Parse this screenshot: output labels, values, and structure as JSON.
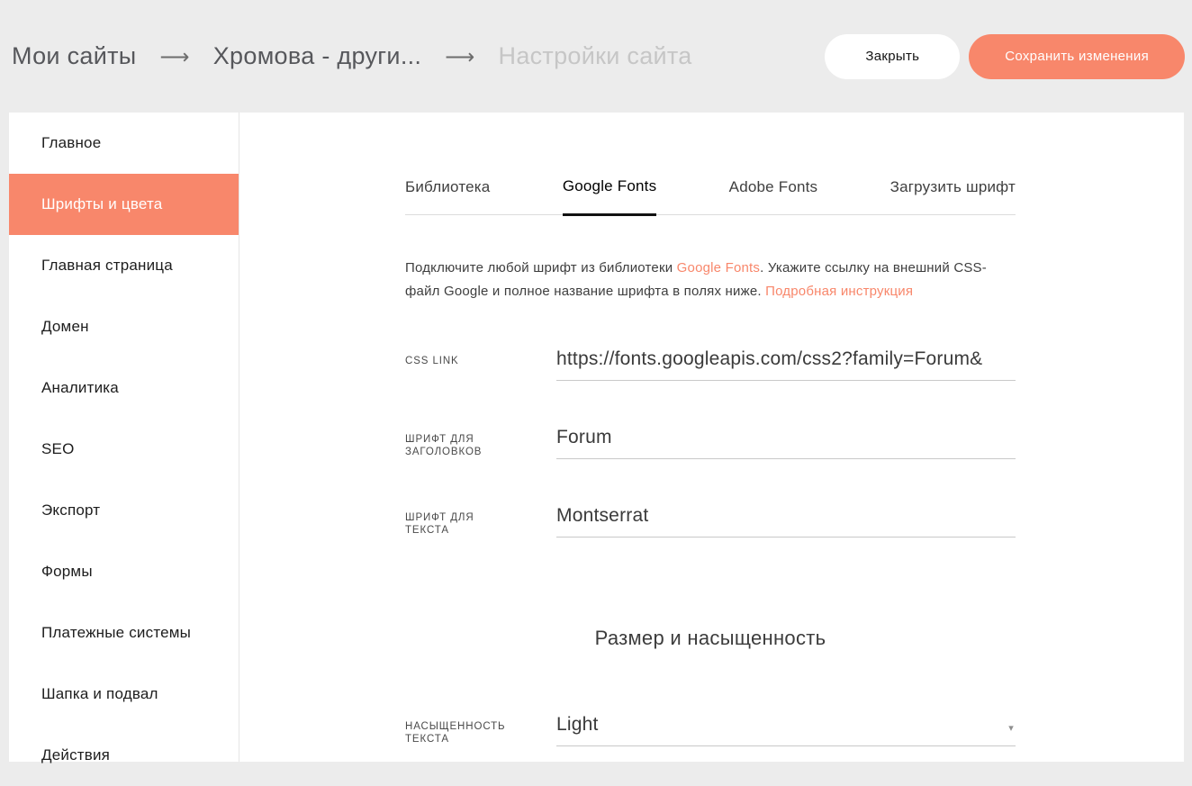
{
  "accent_color": "#f8876b",
  "icons": {
    "breadcrumb_arrow": "⟶",
    "caret_down": "▾"
  },
  "header": {
    "breadcrumb": [
      {
        "label": "Мои сайты"
      },
      {
        "label": "Хромова - други..."
      },
      {
        "label": "Настройки сайта"
      }
    ],
    "close_label": "Закрыть",
    "save_label": "Сохранить изменения"
  },
  "sidebar": {
    "items": [
      {
        "label": "Главное",
        "active": false
      },
      {
        "label": "Шрифты и цвета",
        "active": true
      },
      {
        "label": "Главная страница",
        "active": false
      },
      {
        "label": "Домен",
        "active": false
      },
      {
        "label": "Аналитика",
        "active": false
      },
      {
        "label": "SEO",
        "active": false
      },
      {
        "label": "Экспорт",
        "active": false
      },
      {
        "label": "Формы",
        "active": false
      },
      {
        "label": "Платежные системы",
        "active": false
      },
      {
        "label": "Шапка и подвал",
        "active": false
      },
      {
        "label": "Действия",
        "active": false
      }
    ]
  },
  "main": {
    "tabs": [
      {
        "label": "Библиотека",
        "active": false
      },
      {
        "label": "Google Fonts",
        "active": true
      },
      {
        "label": "Adobe Fonts",
        "active": false
      },
      {
        "label": "Загрузить шрифт",
        "active": false
      }
    ],
    "description": {
      "part1": "Подключите любой шрифт из библиотеки ",
      "link1": "Google Fonts",
      "part2": ". Укажите ссылку на внешний CSS-файл Google и полное название шрифта в полях ниже. ",
      "link2": "Подробная инструкция"
    },
    "fields": [
      {
        "label": "CSS LINK",
        "value": "https://fonts.googleapis.com/css2?family=Forum&"
      },
      {
        "label": "ШРИФТ ДЛЯ ЗАГОЛОВКОВ",
        "value": "Forum"
      },
      {
        "label": "ШРИФТ ДЛЯ ТЕКСТА",
        "value": "Montserrat"
      }
    ],
    "section_title": "Размер и насыщенность",
    "weight_field": {
      "label": "НАСЫЩЕННОСТЬ ТЕКСТА",
      "value": "Light"
    }
  }
}
